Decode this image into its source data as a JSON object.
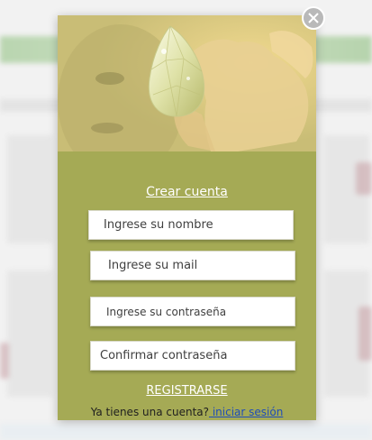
{
  "modal": {
    "title_link": "Crear cuenta",
    "fields": {
      "name_placeholder": "Ingrese su nombre",
      "email_placeholder": "Ingrese su mail",
      "password_placeholder": "Ingrese su contraseña",
      "confirm_placeholder": "Confirmar contraseña"
    },
    "register_label": "REGISTRARSE",
    "login_prompt": "Ya tienes una cuenta?",
    "login_link": " iniciar sesión"
  },
  "icons": {
    "close": "close-icon",
    "hero": "hand-holding-diamond-image"
  },
  "colors": {
    "modal_bg": "#a5aa55",
    "link": "#1f4db8",
    "text_light": "#ffffff"
  }
}
